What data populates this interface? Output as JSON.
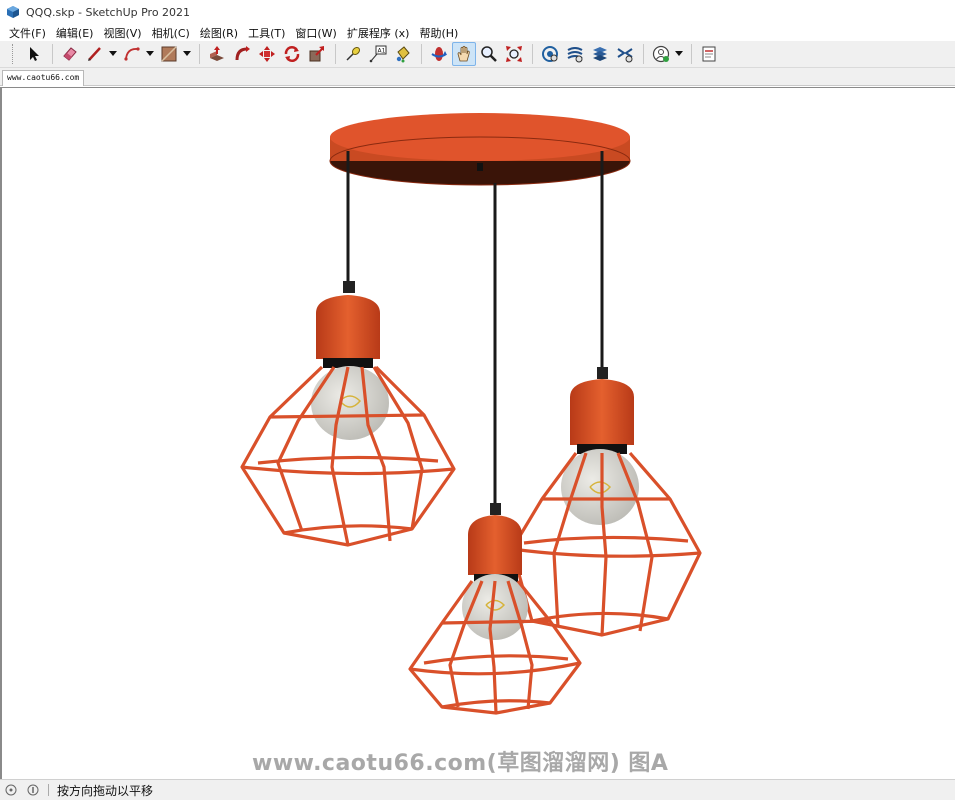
{
  "window": {
    "title": "QQQ.skp - SketchUp Pro 2021",
    "app_icon": "sketchup-icon"
  },
  "menu": {
    "items": [
      {
        "label": "文件(F)"
      },
      {
        "label": "编辑(E)"
      },
      {
        "label": "视图(V)"
      },
      {
        "label": "相机(C)"
      },
      {
        "label": "绘图(R)"
      },
      {
        "label": "工具(T)"
      },
      {
        "label": "窗口(W)"
      },
      {
        "label": "扩展程序 (x)"
      },
      {
        "label": "帮助(H)"
      }
    ]
  },
  "toolbar": {
    "tools": [
      "select-icon",
      "eraser-icon",
      "line-icon",
      "arc-icon",
      "shape-icon",
      "push-pull-icon",
      "follow-me-icon",
      "move-icon",
      "rotate-icon",
      "scale-icon",
      "tape-measure-icon",
      "text-icon",
      "paint-bucket-icon",
      "orbit-icon",
      "pan-icon",
      "zoom-icon",
      "zoom-extents-icon",
      "warehouse-icon",
      "extension-warehouse-icon",
      "layout-icon",
      "extension-manager-icon",
      "account-icon",
      "layout-send-icon"
    ],
    "active_tool": "pan-icon"
  },
  "scene_tabs": {
    "items": [
      {
        "label": "www.caotu66.com"
      }
    ]
  },
  "viewport": {
    "watermark": "www.caotu66.com(草图溜溜网) 图A",
    "colors": {
      "lamp_orange": "#d9502a",
      "canopy_top": "#e0542c",
      "canopy_bottom": "#3a1408",
      "cord": "#1a1a1a",
      "bulb": "#d4d4d0",
      "filament": "#d6b33a"
    }
  },
  "statusbar": {
    "text": "按方向拖动以平移",
    "icons": [
      "geo-location-icon",
      "credits-icon"
    ]
  }
}
